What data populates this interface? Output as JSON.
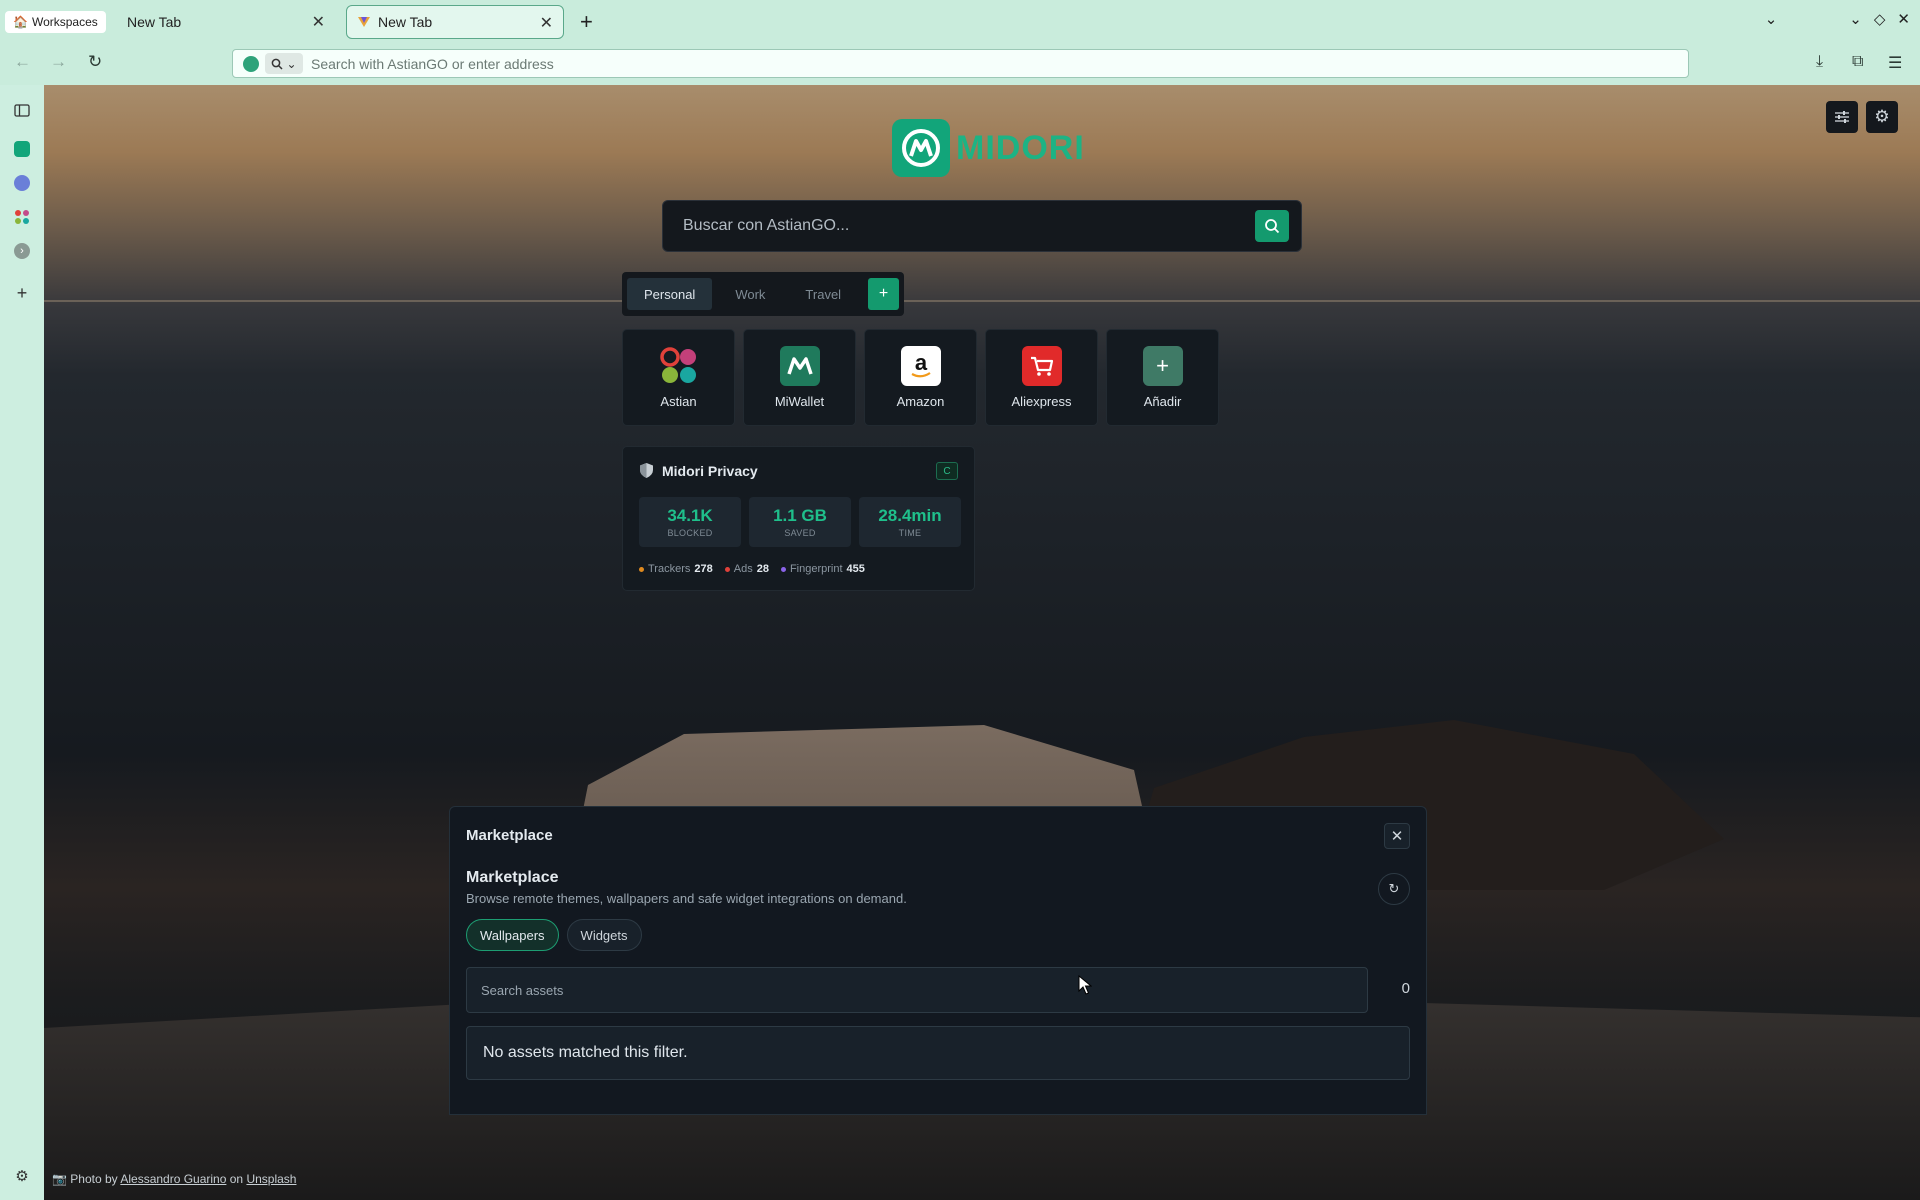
{
  "tabbar": {
    "workspaces_label": "Workspaces",
    "tabs": [
      {
        "title": "New Tab"
      },
      {
        "title": "New Tab"
      }
    ],
    "new_tab": "+"
  },
  "navbar": {
    "address_placeholder": "Search with AstianGO or enter address"
  },
  "page": {
    "logo_text": "MIDORI",
    "search_placeholder": "Buscar con AstianGO...",
    "groups": [
      "Personal",
      "Work",
      "Travel"
    ],
    "group_add": "+",
    "speed_dial": [
      {
        "label": "Astian"
      },
      {
        "label": "MiWallet"
      },
      {
        "label": "Amazon"
      },
      {
        "label": "Aliexpress"
      },
      {
        "label": "Añadir"
      }
    ],
    "privacy": {
      "title": "Midori Privacy",
      "badge": "C",
      "stats": [
        {
          "value": "34.1K",
          "label": "BLOCKED"
        },
        {
          "value": "1.1 GB",
          "label": "SAVED"
        },
        {
          "value": "28.4min",
          "label": "TIME"
        }
      ],
      "legend": [
        {
          "label": "Trackers",
          "count": "278",
          "color": "#e08a1e"
        },
        {
          "label": "Ads",
          "count": "28",
          "color": "#e0413a"
        },
        {
          "label": "Fingerprint",
          "count": "455",
          "color": "#8a63e8"
        }
      ]
    },
    "credit": {
      "prefix": "Photo by",
      "author": "Alessandro Guarino",
      "on": "on",
      "site": "Unsplash"
    }
  },
  "marketplace": {
    "header": "Marketplace",
    "title": "Marketplace",
    "subtitle": "Browse remote themes, wallpapers and safe widget integrations on demand.",
    "tabs": [
      "Wallpapers",
      "Widgets"
    ],
    "search_placeholder": "Search assets",
    "count": "0",
    "empty_message": "No assets matched this filter."
  },
  "colors": {
    "accent": "#149a6e",
    "chrome": "#c9ecdc"
  }
}
